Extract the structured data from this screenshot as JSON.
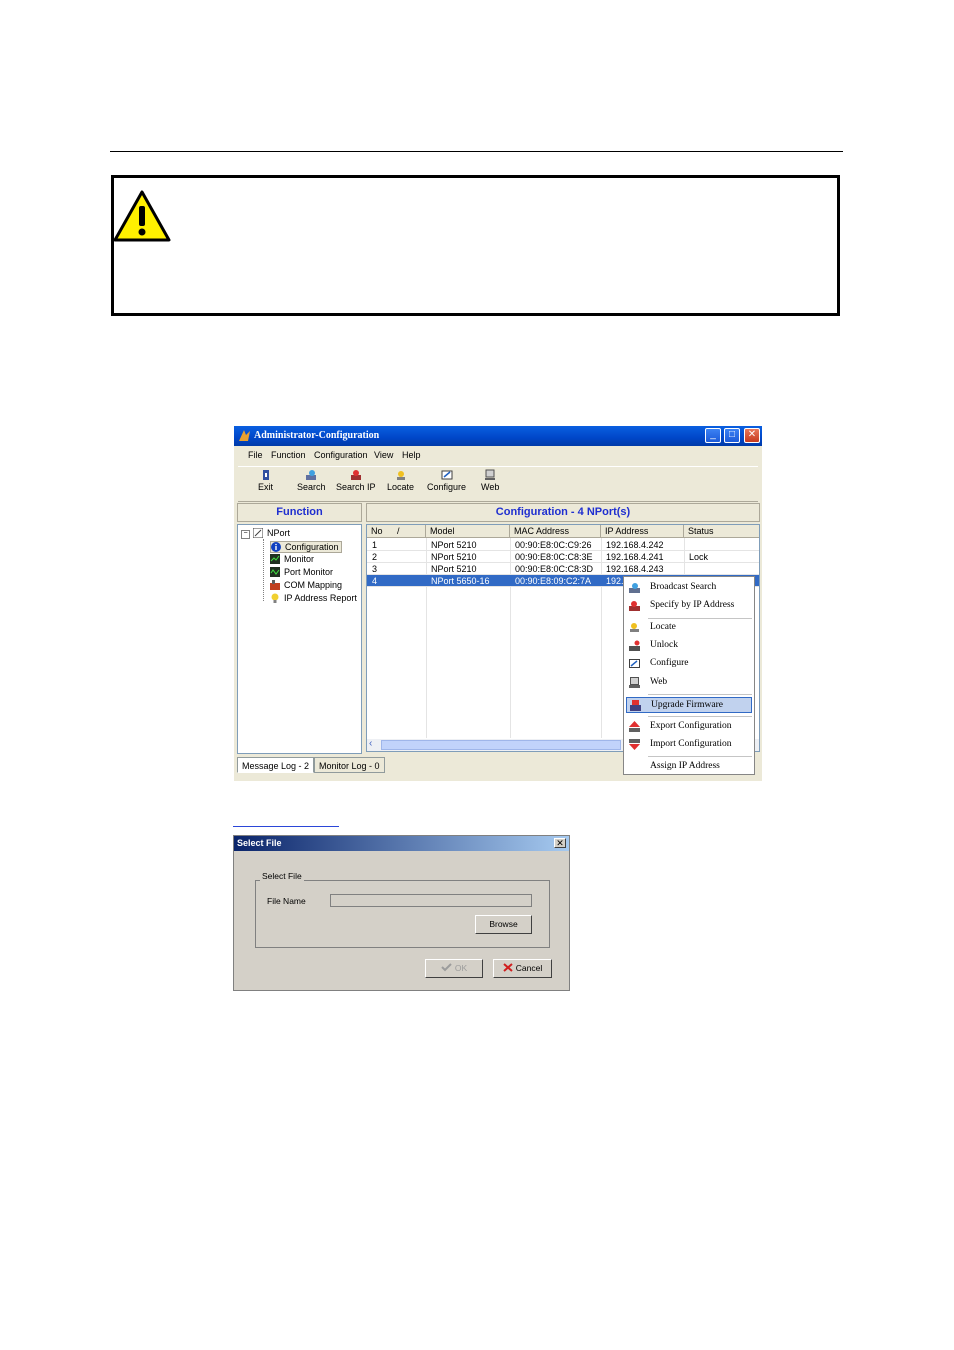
{
  "window": {
    "title": "Administrator-Configuration",
    "menu": [
      "File",
      "Function",
      "Configuration",
      "View",
      "Help"
    ],
    "toolbar": [
      {
        "label": "Exit",
        "icon": "exit-icon"
      },
      {
        "label": "Search",
        "icon": "search-icon"
      },
      {
        "label": "Search IP",
        "icon": "search-ip-icon"
      },
      {
        "label": "Locate",
        "icon": "locate-icon"
      },
      {
        "label": "Configure",
        "icon": "configure-icon"
      },
      {
        "label": "Web",
        "icon": "web-icon"
      }
    ],
    "function_header": "Function",
    "config_header": "Configuration - 4 NPort(s)",
    "tree": {
      "root": "NPort",
      "items": [
        "Configuration",
        "Monitor",
        "Port Monitor",
        "COM Mapping",
        "IP Address Report"
      ]
    },
    "table": {
      "columns": [
        "No",
        "/",
        "Model",
        "MAC Address",
        "IP Address",
        "Status"
      ],
      "rows": [
        {
          "no": "1",
          "model": "NPort 5210",
          "mac": "00:90:E8:0C:C9:26",
          "ip": "192.168.4.242",
          "status": ""
        },
        {
          "no": "2",
          "model": "NPort 5210",
          "mac": "00:90:E8:0C:C8:3E",
          "ip": "192.168.4.241",
          "status": "Lock"
        },
        {
          "no": "3",
          "model": "NPort 5210",
          "mac": "00:90:E8:0C:C8:3D",
          "ip": "192.168.4.243",
          "status": ""
        },
        {
          "no": "4",
          "model": "NPort 5650-16",
          "mac": "00:90:E8:09:C2:7A",
          "ip": "192.",
          "status": ""
        }
      ]
    },
    "tabs": [
      "Message Log - 2",
      "Monitor Log - 0"
    ],
    "context_menu": [
      "Broadcast Search",
      "Specify by IP Address",
      "Locate",
      "Unlock",
      "Configure",
      "Web",
      "Upgrade Firmware",
      "Export Configuration",
      "Import Configuration",
      "Assign IP Address"
    ],
    "colors": {
      "title_blue": "#0046c8",
      "header_text": "#1f2fd0",
      "selection": "#316ac5"
    }
  },
  "dialog": {
    "title": "Select File",
    "close": "✕",
    "group_label": "Select File",
    "file_name_label": "File Name",
    "file_name_value": "",
    "browse": "Browse",
    "ok": "OK",
    "cancel": "Cancel"
  }
}
